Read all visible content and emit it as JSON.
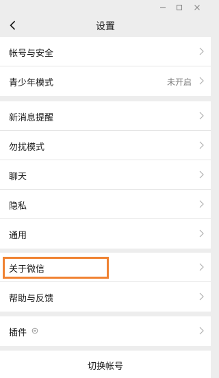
{
  "window": {
    "controls": {
      "minimize_icon": "minimize-icon",
      "maximize_icon": "maximize-icon",
      "close_icon": "close-icon"
    }
  },
  "header": {
    "title": "设置",
    "back_icon": "chevron-left-icon"
  },
  "groups": [
    {
      "items": [
        {
          "label": "帐号与安全"
        },
        {
          "label": "青少年模式",
          "value": "未开启"
        }
      ]
    },
    {
      "items": [
        {
          "label": "新消息提醒"
        },
        {
          "label": "勿扰模式"
        },
        {
          "label": "聊天"
        },
        {
          "label": "隐私"
        },
        {
          "label": "通用"
        }
      ]
    },
    {
      "items": [
        {
          "label": "关于微信",
          "highlighted": true
        },
        {
          "label": "帮助与反馈"
        }
      ]
    },
    {
      "items": [
        {
          "label": "插件",
          "icon": "plugin-icon"
        }
      ]
    }
  ],
  "footer": {
    "switch_account": "切换帐号"
  },
  "colors": {
    "background": "#ededed",
    "row_background": "#ffffff",
    "highlight_border": "#f08232",
    "secondary_text": "#7f7f7f"
  }
}
